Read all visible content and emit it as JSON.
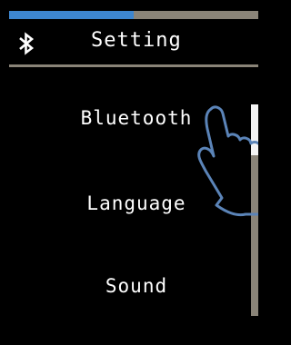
{
  "header": {
    "title": "Setting",
    "icon": "bluetooth-icon"
  },
  "progress": {
    "value": 0.5,
    "color": "#3d86d0"
  },
  "menu": {
    "items": [
      {
        "label": "Bluetooth"
      },
      {
        "label": "Language"
      },
      {
        "label": "Sound"
      }
    ]
  },
  "gesture": {
    "icon": "pointing-hand-icon",
    "color": "#5b84b8"
  },
  "colors": {
    "background": "#000000",
    "accent": "#3d86d0",
    "track": "#8a8478"
  }
}
